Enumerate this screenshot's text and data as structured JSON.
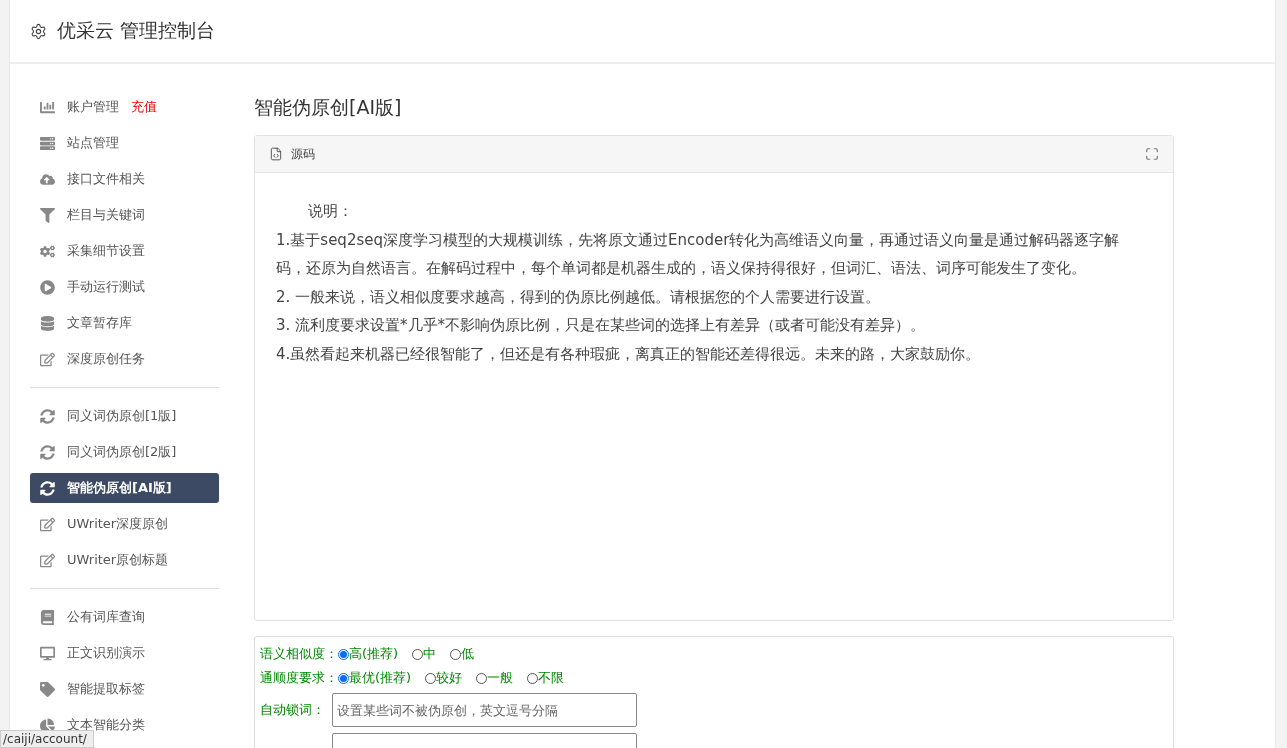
{
  "header": {
    "title": "优采云 管理控制台"
  },
  "sidebar": {
    "groups": [
      {
        "items": [
          {
            "label": "账户管理",
            "badge": "充值",
            "kind": "chart",
            "selected": false
          },
          {
            "label": "站点管理",
            "kind": "server",
            "selected": false
          },
          {
            "label": "接口文件相关",
            "kind": "cloud",
            "selected": false
          },
          {
            "label": "栏目与关键词",
            "kind": "filter",
            "selected": false
          },
          {
            "label": "采集细节设置",
            "kind": "cogs",
            "selected": false
          },
          {
            "label": "手动运行测试",
            "kind": "play",
            "selected": false
          },
          {
            "label": "文章暂存库",
            "kind": "database",
            "selected": false
          },
          {
            "label": "深度原创任务",
            "kind": "edit",
            "selected": false
          }
        ]
      },
      {
        "items": [
          {
            "label": "同义词伪原创[1版]",
            "kind": "sync",
            "selected": false
          },
          {
            "label": "同义词伪原创[2版]",
            "kind": "sync",
            "selected": false
          },
          {
            "label": "智能伪原创[AI版]",
            "kind": "sync",
            "selected": true
          },
          {
            "label": "UWriter深度原创",
            "kind": "edit",
            "selected": false
          },
          {
            "label": "UWriter原创标题",
            "kind": "edit",
            "selected": false
          }
        ]
      },
      {
        "items": [
          {
            "label": "公有词库查询",
            "kind": "book",
            "selected": false
          },
          {
            "label": "正文识别演示",
            "kind": "desktop",
            "selected": false
          },
          {
            "label": "智能提取标签",
            "kind": "tag",
            "selected": false
          },
          {
            "label": "文本智能分类",
            "kind": "pie",
            "selected": false
          }
        ]
      }
    ]
  },
  "page_title": "智能伪原创[AI版]",
  "source_panel": {
    "title": "源码",
    "heading": "说明：",
    "paragraphs": [
      "1.基于seq2seq深度学习模型的大规模训练，先将原文通过Encoder转化为高维语义向量，再通过语义向量是通过解码器逐字解码，还原为自然语言。在解码过程中，每个单词都是机器生成的，语义保持得很好，但词汇、语法、词序可能发生了变化。",
      "2. 一般来说，语义相似度要求越高，得到的伪原比例越低。请根据您的个人需要进行设置。",
      "3. 流利度要求设置*几乎*不影响伪原比例，只是在某些词的选择上有差异（或者可能没有差异）。",
      "4.虽然看起来机器已经很智能了，但还是有各种瑕疵，离真正的智能还差得很远。未来的路，大家鼓励你。"
    ]
  },
  "settings": {
    "radio_groups": [
      {
        "label": "语义相似度：",
        "options": [
          {
            "label": "高(推荐)",
            "selected": true
          },
          {
            "label": "中",
            "selected": false
          },
          {
            "label": "低",
            "selected": false
          }
        ]
      },
      {
        "label": "通顺度要求：",
        "options": [
          {
            "label": "最优(推荐)",
            "selected": true
          },
          {
            "label": "较好",
            "selected": false
          },
          {
            "label": "一般",
            "selected": false
          },
          {
            "label": "不限",
            "selected": false
          }
        ]
      }
    ],
    "fields": [
      {
        "kind": "input",
        "label": "自动锁词：",
        "placeholder": "设置某些词不被伪原创，英文逗号分隔"
      },
      {
        "kind": "input"
      }
    ]
  },
  "status_bar": {
    "url": "/caiji/account/"
  }
}
